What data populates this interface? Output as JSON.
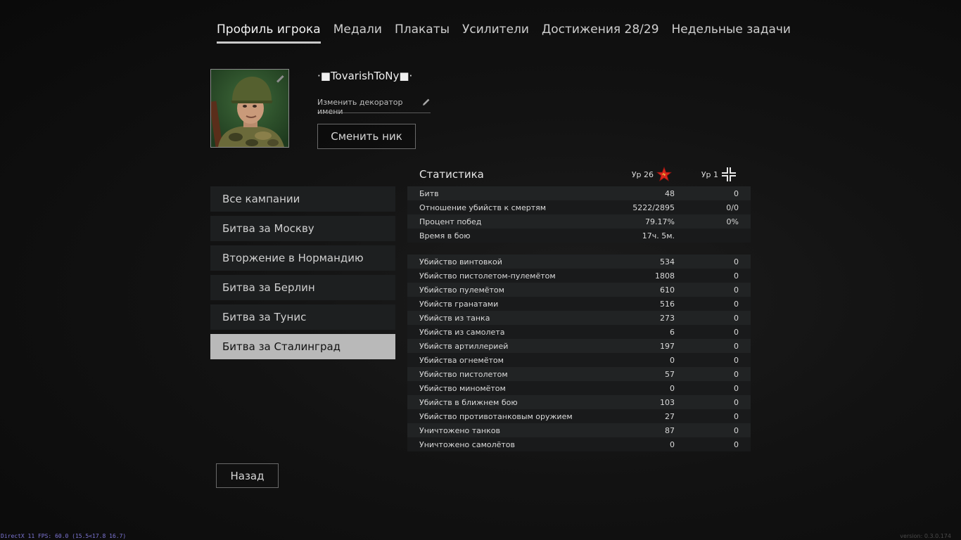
{
  "nav": {
    "tabs": [
      {
        "label": "Профиль игрока"
      },
      {
        "label": "Медали"
      },
      {
        "label": "Плакаты"
      },
      {
        "label": "Усилители"
      },
      {
        "label": "Достижения 28/29"
      },
      {
        "label": "Недельные задачи"
      }
    ]
  },
  "profile": {
    "nickname": "·■TovarishToNy■·",
    "change_decorator_label": "Изменить декоратор имени",
    "change_nick_label": "Сменить ник"
  },
  "campaigns": [
    {
      "label": "Все кампании"
    },
    {
      "label": "Битва за Москву"
    },
    {
      "label": "Вторжение в Нормандию"
    },
    {
      "label": "Битва за Берлин"
    },
    {
      "label": "Битва за Тунис"
    },
    {
      "label": "Битва за Сталинград",
      "active": true
    }
  ],
  "stats": {
    "title": "Статистика",
    "level_allies": "Ур 26",
    "level_axis": "Ур 1",
    "summary": [
      {
        "label": "Битв",
        "v1": "48",
        "v2": "0"
      },
      {
        "label": "Отношение убийств к смертям",
        "v1": "5222/2895",
        "v2": "0/0"
      },
      {
        "label": "Процент побед",
        "v1": "79.17%",
        "v2": "0%"
      },
      {
        "label": "Время в бою",
        "v1": "17ч. 5м.",
        "v2": ""
      }
    ],
    "kills": [
      {
        "label": "Убийство винтовкой",
        "v1": "534",
        "v2": "0"
      },
      {
        "label": "Убийство пистолетом-пулемётом",
        "v1": "1808",
        "v2": "0"
      },
      {
        "label": "Убийство пулемётом",
        "v1": "610",
        "v2": "0"
      },
      {
        "label": "Убийств гранатами",
        "v1": "516",
        "v2": "0"
      },
      {
        "label": "Убийств из танка",
        "v1": "273",
        "v2": "0"
      },
      {
        "label": "Убийств из самолета",
        "v1": "6",
        "v2": "0"
      },
      {
        "label": "Убийств артиллерией",
        "v1": "197",
        "v2": "0"
      },
      {
        "label": "Убийства огнемётом",
        "v1": "0",
        "v2": "0"
      },
      {
        "label": "Убийство пистолетом",
        "v1": "57",
        "v2": "0"
      },
      {
        "label": "Убийство миномётом",
        "v1": "0",
        "v2": "0"
      },
      {
        "label": "Убийств в ближнем бою",
        "v1": "103",
        "v2": "0"
      },
      {
        "label": "Убийство противотанковым оружием",
        "v1": "27",
        "v2": "0"
      },
      {
        "label": "Уничтожено танков",
        "v1": "87",
        "v2": "0"
      },
      {
        "label": "Уничтожено самолётов",
        "v1": "0",
        "v2": "0"
      }
    ]
  },
  "back_label": "Назад",
  "footer": {
    "fps": "DirectX 11 FPS: 60.0 (15.5<17.8 16.7)",
    "version": "version: 0.3.0.174"
  },
  "colors": {
    "active_campaign_bg": "#b9b9b9",
    "allied_star": "#d9261c"
  },
  "icons": {
    "pencil": "pencil-icon",
    "allies_level": "soviet-star-icon",
    "axis_level": "balkenkreuz-icon"
  }
}
